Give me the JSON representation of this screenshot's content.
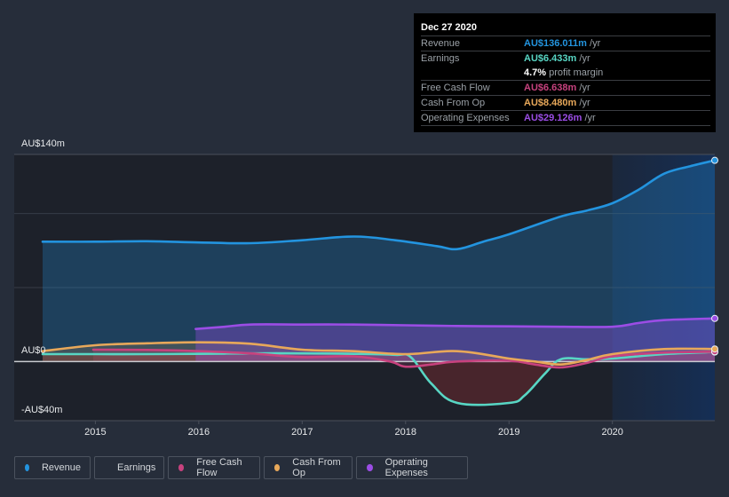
{
  "chart_data": {
    "type": "line",
    "title": "",
    "xlabel": "",
    "ylabel": "",
    "currency_unit": "AU$m",
    "xlim": [
      2014.49,
      2020.99
    ],
    "ylim": [
      -40,
      140
    ],
    "y_ticks": [
      {
        "value": 140,
        "label": "AU$140m"
      },
      {
        "value": 0,
        "label": "AU$0"
      },
      {
        "value": -40,
        "label": "-AU$40m"
      }
    ],
    "y_gridlines": [
      140,
      100,
      50,
      0,
      -40
    ],
    "x_ticks": [
      {
        "value": 2015,
        "label": "2015"
      },
      {
        "value": 2016,
        "label": "2016"
      },
      {
        "value": 2017,
        "label": "2017"
      },
      {
        "value": 2018,
        "label": "2018"
      },
      {
        "value": 2019,
        "label": "2019"
      },
      {
        "value": 2020,
        "label": "2020"
      }
    ],
    "highlight_range": [
      2020.0,
      2020.99
    ],
    "grid": true,
    "legend_position": "bottom",
    "series": [
      {
        "name": "Revenue",
        "color": "#2394df",
        "fill": true,
        "points": [
          [
            2014.49,
            81
          ],
          [
            2015.0,
            81
          ],
          [
            2015.5,
            81.3
          ],
          [
            2016.0,
            80.5
          ],
          [
            2016.5,
            80
          ],
          [
            2017.0,
            82
          ],
          [
            2017.5,
            84.5
          ],
          [
            2017.9,
            82
          ],
          [
            2018.3,
            78
          ],
          [
            2018.5,
            76
          ],
          [
            2018.75,
            81
          ],
          [
            2019.0,
            86
          ],
          [
            2019.5,
            98
          ],
          [
            2019.75,
            102
          ],
          [
            2020.0,
            107
          ],
          [
            2020.25,
            116
          ],
          [
            2020.5,
            127
          ],
          [
            2020.75,
            132
          ],
          [
            2020.99,
            136.011
          ]
        ]
      },
      {
        "name": "Earnings",
        "color": "#58d6c4",
        "fill": true,
        "points": [
          [
            2014.49,
            5
          ],
          [
            2015.0,
            5
          ],
          [
            2015.5,
            5
          ],
          [
            2016.0,
            5.2
          ],
          [
            2016.5,
            5.5
          ],
          [
            2017.0,
            5.5
          ],
          [
            2017.5,
            5.2
          ],
          [
            2017.9,
            4.5
          ],
          [
            2018.05,
            3
          ],
          [
            2018.25,
            -15
          ],
          [
            2018.5,
            -28
          ],
          [
            2019.0,
            -28
          ],
          [
            2019.15,
            -23
          ],
          [
            2019.35,
            -8
          ],
          [
            2019.5,
            1.5
          ],
          [
            2019.75,
            1.5
          ],
          [
            2020.0,
            2
          ],
          [
            2020.5,
            5
          ],
          [
            2020.99,
            6.433
          ]
        ]
      },
      {
        "name": "Free Cash Flow",
        "color": "#c7427e",
        "fill": true,
        "points": [
          [
            2014.98,
            8
          ],
          [
            2015.5,
            7.8
          ],
          [
            2016.0,
            7
          ],
          [
            2016.5,
            5.5
          ],
          [
            2017.0,
            3
          ],
          [
            2017.5,
            3.5
          ],
          [
            2017.85,
            0
          ],
          [
            2018.0,
            -3.5
          ],
          [
            2018.25,
            -2
          ],
          [
            2018.5,
            0
          ],
          [
            2019.0,
            0.5
          ],
          [
            2019.25,
            -2
          ],
          [
            2019.5,
            -4
          ],
          [
            2019.75,
            -1
          ],
          [
            2020.0,
            3.5
          ],
          [
            2020.5,
            6
          ],
          [
            2020.99,
            6.638
          ]
        ]
      },
      {
        "name": "Cash From Op",
        "color": "#e8a85a",
        "fill": true,
        "points": [
          [
            2014.49,
            7
          ],
          [
            2015.0,
            11
          ],
          [
            2015.5,
            12.3
          ],
          [
            2016.0,
            13
          ],
          [
            2016.5,
            12
          ],
          [
            2017.0,
            8
          ],
          [
            2017.5,
            7
          ],
          [
            2018.0,
            5
          ],
          [
            2018.5,
            7
          ],
          [
            2019.0,
            2
          ],
          [
            2019.25,
            0
          ],
          [
            2019.5,
            -2
          ],
          [
            2019.75,
            1
          ],
          [
            2020.0,
            5
          ],
          [
            2020.5,
            8.4
          ],
          [
            2020.99,
            8.48
          ]
        ]
      },
      {
        "name": "Operating Expenses",
        "color": "#9b4de5",
        "fill": true,
        "points": [
          [
            2015.97,
            22
          ],
          [
            2016.25,
            23.5
          ],
          [
            2016.5,
            25
          ],
          [
            2017.0,
            25
          ],
          [
            2017.5,
            25
          ],
          [
            2018.0,
            24.5
          ],
          [
            2018.5,
            24
          ],
          [
            2019.0,
            23.8
          ],
          [
            2019.5,
            23.5
          ],
          [
            2020.0,
            23.5
          ],
          [
            2020.25,
            26
          ],
          [
            2020.5,
            28
          ],
          [
            2020.99,
            29.126
          ]
        ]
      }
    ]
  },
  "tooltip": {
    "date": "Dec 27 2020",
    "rows": [
      {
        "label": "Revenue",
        "value": "AU$136.011m",
        "unit": " /yr",
        "color": "#2394df"
      },
      {
        "label": "Earnings",
        "value": "AU$6.433m",
        "unit": " /yr",
        "color": "#58d6c4"
      },
      {
        "label": "",
        "value": "4.7%",
        "unit": " profit margin",
        "color": "#ffffff"
      },
      {
        "label": "Free Cash Flow",
        "value": "AU$6.638m",
        "unit": " /yr",
        "color": "#c7427e"
      },
      {
        "label": "Cash From Op",
        "value": "AU$8.480m",
        "unit": " /yr",
        "color": "#e8a85a"
      },
      {
        "label": "Operating Expenses",
        "value": "AU$29.126m",
        "unit": " /yr",
        "color": "#9b4de5"
      }
    ]
  },
  "legend": [
    {
      "label": "Revenue",
      "color": "#2394df"
    },
    {
      "label": "Earnings",
      "color": "#58d6c4"
    },
    {
      "label": "Free Cash Flow",
      "color": "#c7427e"
    },
    {
      "label": "Cash From Op",
      "color": "#e8a85a"
    },
    {
      "label": "Operating Expenses",
      "color": "#9b4de5"
    }
  ]
}
